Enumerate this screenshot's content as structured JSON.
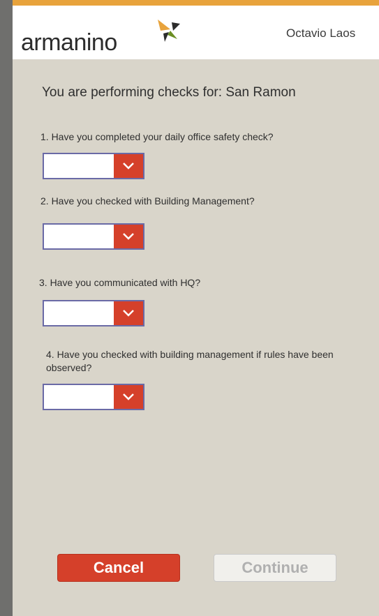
{
  "header": {
    "logo_text": "armanino",
    "user_name": "Octavio Laos"
  },
  "colors": {
    "accent_orange": "#e8a33c",
    "accent_red": "#d5402a",
    "panel_background": "#d9d5ca"
  },
  "form": {
    "performing_text": "You are performing checks for: San Ramon",
    "questions": [
      {
        "label": "1. Have you completed your daily office safety check?",
        "selected_value": ""
      },
      {
        "label": "2. Have you checked with Building Management?",
        "selected_value": ""
      },
      {
        "label": "3. Have you communicated with HQ?",
        "selected_value": ""
      },
      {
        "label": "4. Have you checked with building management if rules have been observed?",
        "selected_value": ""
      }
    ]
  },
  "actions": {
    "cancel_label": "Cancel",
    "continue_label": "Continue"
  }
}
